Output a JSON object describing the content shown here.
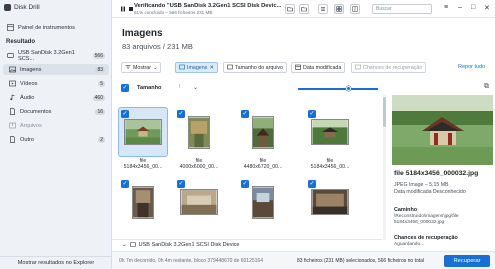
{
  "app": {
    "name": "Disk Drill"
  },
  "sidebar": {
    "dashboard": "Painel de instrumentos",
    "section": "Resultado",
    "device": {
      "label": "USB  SanDisk 3.2Gen1 SCS...",
      "count": "566"
    },
    "items": [
      {
        "label": "Imagens",
        "count": "83"
      },
      {
        "label": "Vídeos",
        "count": "5"
      },
      {
        "label": "Áudio",
        "count": "460"
      },
      {
        "label": "Documentos",
        "count": "16"
      },
      {
        "label": "Arquivos",
        "count": ""
      },
      {
        "label": "Outro",
        "count": "2"
      }
    ],
    "show_explorer": "Mostrar resultados no Explorer"
  },
  "topbar": {
    "title": "Verificando \"USB  SanDisk 3.2Gen1 SCSI Disk Devic...",
    "subtitle": "61% concluído – 566 ficheiros  231 MB",
    "search_placeholder": "Buscar",
    "progress_percent": 61
  },
  "main": {
    "title": "Imagens",
    "subtitle": "83 arquivos / 231 MB"
  },
  "filters": {
    "show": "Mostrar",
    "images": "Imagens",
    "file_size": "Tamanho do arquivo",
    "date_modified": "Data modificada",
    "recovery_chances": "Chances de recuperação",
    "reset": "Repor tudo"
  },
  "sort": {
    "label": "Tamanho"
  },
  "grid": {
    "tiles": [
      {
        "line1": "file",
        "line2": "5184x3456_00...",
        "selected": true
      },
      {
        "line1": "file",
        "line2": "4000x6000_00...",
        "selected": false
      },
      {
        "line1": "file",
        "line2": "4480x6720_00...",
        "selected": false
      },
      {
        "line1": "file",
        "line2": "5184x3456_00...",
        "selected": false
      },
      {
        "line1": "",
        "line2": "",
        "selected": false
      },
      {
        "line1": "",
        "line2": "",
        "selected": false
      },
      {
        "line1": "",
        "line2": "",
        "selected": false
      },
      {
        "line1": "",
        "line2": "",
        "selected": false
      }
    ],
    "disk_label": "USB  SanDisk 3.2Gen1 SCSI Disk Device"
  },
  "preview": {
    "title": "file 5184x3456_000032.jpg",
    "type": "JPEG Image – 5,15 MB",
    "date": "Data modificada Desconhecido",
    "path_label": "Caminho",
    "path_value": "\\Reconstruído\\imagens\\jpg\\file 5184x3456_000032.jpg",
    "chances_label": "Chances de recuperação",
    "chances_value": "Aguardando..."
  },
  "bottombar": {
    "left": "0h 7m decorrido, 0h 4m restante, bloco 379448670 de 60125164",
    "right": "83 ficheiros (231 MB) selecionados, 566 ficheiros no total",
    "recover": "Recuperar"
  },
  "colors": {
    "accent": "#1a6fd6",
    "selected_tile": "#d6e6f7"
  }
}
